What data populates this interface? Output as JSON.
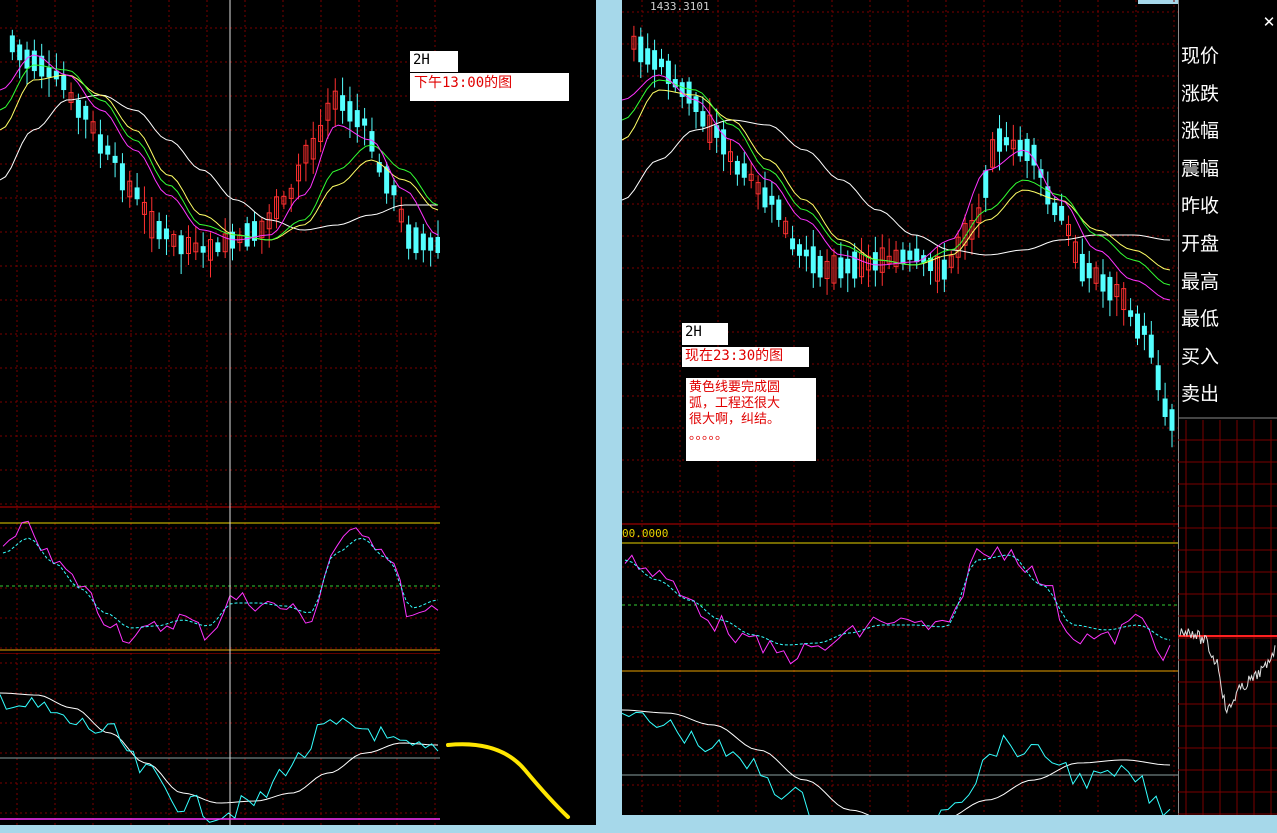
{
  "left_chart": {
    "timeframe_label": "2H",
    "note": "下午13:00的图"
  },
  "right_chart": {
    "price_top": "1433.3101",
    "timeframe_label": "2H",
    "note": "现在23:30的图",
    "comment_lines": [
      "黄色线要完成圆",
      "弧，工程还很大",
      "很大啊，纠结。",
      "。。。。。"
    ],
    "oscillator_value": "00.0000"
  },
  "side_menu": {
    "close_symbol": "✕",
    "items": [
      "现价",
      "涨跌",
      "涨幅",
      "震幅",
      "昨收",
      "开盘",
      "最高",
      "最低",
      "买入",
      "卖出"
    ]
  },
  "colors": {
    "background": "#000000",
    "grid": "#7a0000",
    "up_candle": "#ff3030",
    "down_candle": "#54ffff",
    "ma_white": "#ffffff",
    "ma_yellow": "#ffff66",
    "ma_green": "#33ff33",
    "ma_magenta": "#ff33ff",
    "osc_magenta": "#ff33ff",
    "osc_cyan": "#33ffff",
    "hand_drawn_arc": "#ffe600",
    "frame_border": "#a6d8ea"
  }
}
